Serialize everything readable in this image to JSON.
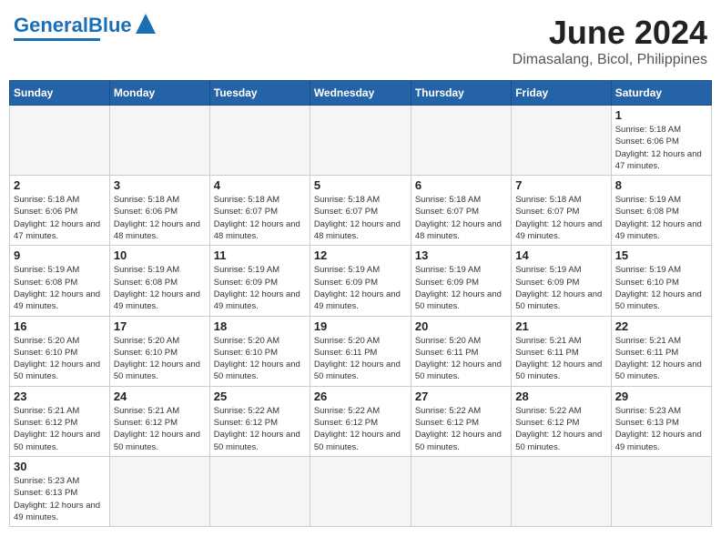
{
  "header": {
    "logo_general": "General",
    "logo_blue": "Blue",
    "main_title": "June 2024",
    "subtitle": "Dimasalang, Bicol, Philippines"
  },
  "days_of_week": [
    "Sunday",
    "Monday",
    "Tuesday",
    "Wednesday",
    "Thursday",
    "Friday",
    "Saturday"
  ],
  "weeks": [
    [
      {
        "day": "",
        "info": ""
      },
      {
        "day": "",
        "info": ""
      },
      {
        "day": "",
        "info": ""
      },
      {
        "day": "",
        "info": ""
      },
      {
        "day": "",
        "info": ""
      },
      {
        "day": "",
        "info": ""
      },
      {
        "day": "1",
        "info": "Sunrise: 5:18 AM\nSunset: 6:06 PM\nDaylight: 12 hours and 47 minutes."
      }
    ],
    [
      {
        "day": "2",
        "info": "Sunrise: 5:18 AM\nSunset: 6:06 PM\nDaylight: 12 hours and 47 minutes."
      },
      {
        "day": "3",
        "info": "Sunrise: 5:18 AM\nSunset: 6:06 PM\nDaylight: 12 hours and 48 minutes."
      },
      {
        "day": "4",
        "info": "Sunrise: 5:18 AM\nSunset: 6:07 PM\nDaylight: 12 hours and 48 minutes."
      },
      {
        "day": "5",
        "info": "Sunrise: 5:18 AM\nSunset: 6:07 PM\nDaylight: 12 hours and 48 minutes."
      },
      {
        "day": "6",
        "info": "Sunrise: 5:18 AM\nSunset: 6:07 PM\nDaylight: 12 hours and 48 minutes."
      },
      {
        "day": "7",
        "info": "Sunrise: 5:18 AM\nSunset: 6:07 PM\nDaylight: 12 hours and 49 minutes."
      },
      {
        "day": "8",
        "info": "Sunrise: 5:19 AM\nSunset: 6:08 PM\nDaylight: 12 hours and 49 minutes."
      }
    ],
    [
      {
        "day": "9",
        "info": "Sunrise: 5:19 AM\nSunset: 6:08 PM\nDaylight: 12 hours and 49 minutes."
      },
      {
        "day": "10",
        "info": "Sunrise: 5:19 AM\nSunset: 6:08 PM\nDaylight: 12 hours and 49 minutes."
      },
      {
        "day": "11",
        "info": "Sunrise: 5:19 AM\nSunset: 6:09 PM\nDaylight: 12 hours and 49 minutes."
      },
      {
        "day": "12",
        "info": "Sunrise: 5:19 AM\nSunset: 6:09 PM\nDaylight: 12 hours and 49 minutes."
      },
      {
        "day": "13",
        "info": "Sunrise: 5:19 AM\nSunset: 6:09 PM\nDaylight: 12 hours and 50 minutes."
      },
      {
        "day": "14",
        "info": "Sunrise: 5:19 AM\nSunset: 6:09 PM\nDaylight: 12 hours and 50 minutes."
      },
      {
        "day": "15",
        "info": "Sunrise: 5:19 AM\nSunset: 6:10 PM\nDaylight: 12 hours and 50 minutes."
      }
    ],
    [
      {
        "day": "16",
        "info": "Sunrise: 5:20 AM\nSunset: 6:10 PM\nDaylight: 12 hours and 50 minutes."
      },
      {
        "day": "17",
        "info": "Sunrise: 5:20 AM\nSunset: 6:10 PM\nDaylight: 12 hours and 50 minutes."
      },
      {
        "day": "18",
        "info": "Sunrise: 5:20 AM\nSunset: 6:10 PM\nDaylight: 12 hours and 50 minutes."
      },
      {
        "day": "19",
        "info": "Sunrise: 5:20 AM\nSunset: 6:11 PM\nDaylight: 12 hours and 50 minutes."
      },
      {
        "day": "20",
        "info": "Sunrise: 5:20 AM\nSunset: 6:11 PM\nDaylight: 12 hours and 50 minutes."
      },
      {
        "day": "21",
        "info": "Sunrise: 5:21 AM\nSunset: 6:11 PM\nDaylight: 12 hours and 50 minutes."
      },
      {
        "day": "22",
        "info": "Sunrise: 5:21 AM\nSunset: 6:11 PM\nDaylight: 12 hours and 50 minutes."
      }
    ],
    [
      {
        "day": "23",
        "info": "Sunrise: 5:21 AM\nSunset: 6:12 PM\nDaylight: 12 hours and 50 minutes."
      },
      {
        "day": "24",
        "info": "Sunrise: 5:21 AM\nSunset: 6:12 PM\nDaylight: 12 hours and 50 minutes."
      },
      {
        "day": "25",
        "info": "Sunrise: 5:22 AM\nSunset: 6:12 PM\nDaylight: 12 hours and 50 minutes."
      },
      {
        "day": "26",
        "info": "Sunrise: 5:22 AM\nSunset: 6:12 PM\nDaylight: 12 hours and 50 minutes."
      },
      {
        "day": "27",
        "info": "Sunrise: 5:22 AM\nSunset: 6:12 PM\nDaylight: 12 hours and 50 minutes."
      },
      {
        "day": "28",
        "info": "Sunrise: 5:22 AM\nSunset: 6:12 PM\nDaylight: 12 hours and 50 minutes."
      },
      {
        "day": "29",
        "info": "Sunrise: 5:23 AM\nSunset: 6:13 PM\nDaylight: 12 hours and 49 minutes."
      }
    ],
    [
      {
        "day": "30",
        "info": "Sunrise: 5:23 AM\nSunset: 6:13 PM\nDaylight: 12 hours and 49 minutes."
      },
      {
        "day": "",
        "info": ""
      },
      {
        "day": "",
        "info": ""
      },
      {
        "day": "",
        "info": ""
      },
      {
        "day": "",
        "info": ""
      },
      {
        "day": "",
        "info": ""
      },
      {
        "day": "",
        "info": ""
      }
    ]
  ]
}
